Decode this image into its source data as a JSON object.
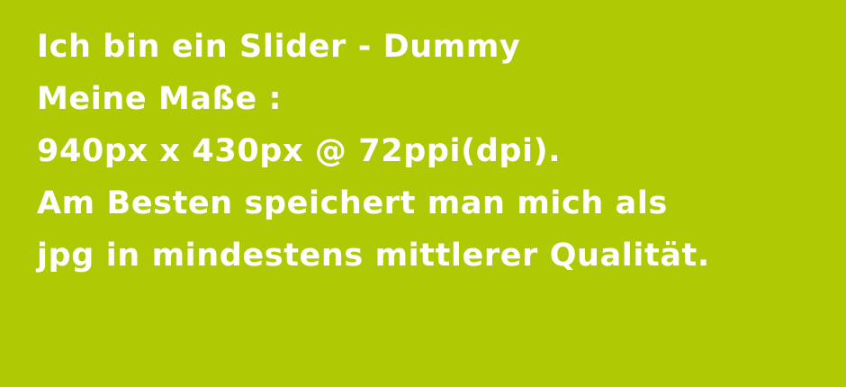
{
  "slide": {
    "background_color": "#afca05",
    "text_color": "#ffffff",
    "lines": [
      "Ich bin ein Slider - Dummy",
      "Meine Maße :",
      "940px x 430px @ 72ppi(dpi).",
      "Am Besten speichert man mich als",
      "jpg in mindestens mittlerer Qualität."
    ]
  }
}
